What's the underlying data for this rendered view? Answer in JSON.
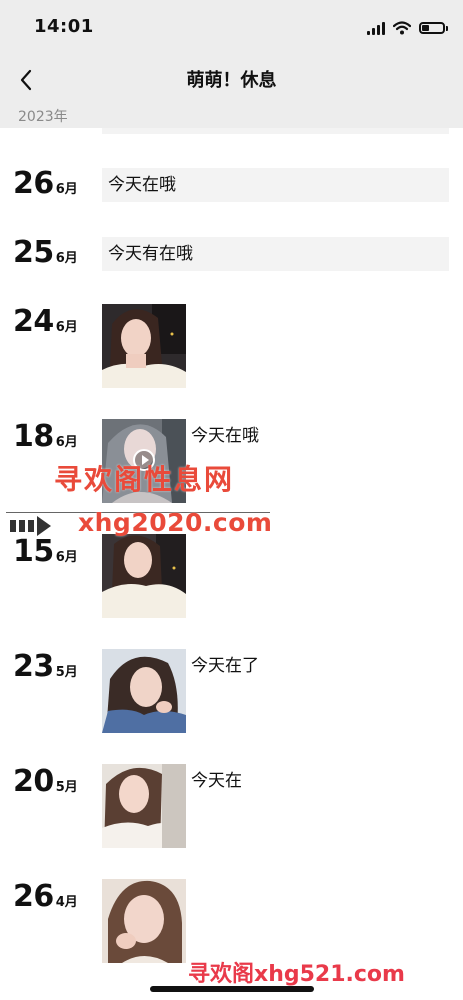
{
  "status_bar": {
    "time": "14:01",
    "battery_level": 0.35
  },
  "nav": {
    "title": "萌萌！休息",
    "back_icon": "chevron-left-icon"
  },
  "year_header": "2023年",
  "posts": [
    {
      "day": "26",
      "month": "6月",
      "type": "text",
      "text": "今天在哦"
    },
    {
      "day": "25",
      "month": "6月",
      "type": "text",
      "text": "今天有在哦"
    },
    {
      "day": "24",
      "month": "6月",
      "type": "photo",
      "caption": ""
    },
    {
      "day": "18",
      "month": "6月",
      "type": "video",
      "caption": "今天在哦"
    },
    {
      "day": "15",
      "month": "6月",
      "type": "photo",
      "caption": ""
    },
    {
      "day": "23",
      "month": "5月",
      "type": "photo",
      "caption": "今天在了"
    },
    {
      "day": "20",
      "month": "5月",
      "type": "photo",
      "caption": "今天在"
    },
    {
      "day": "26",
      "month": "4月",
      "type": "photo",
      "caption": ""
    }
  ],
  "watermarks": {
    "main": "寻欢阁性息网",
    "url": "xhg2020.com",
    "bottom": "寻欢阁xhg521.com"
  },
  "colors": {
    "bar_background": "#ededed",
    "text_box_background": "#f3f3f3",
    "watermark": "#e94a3a"
  }
}
